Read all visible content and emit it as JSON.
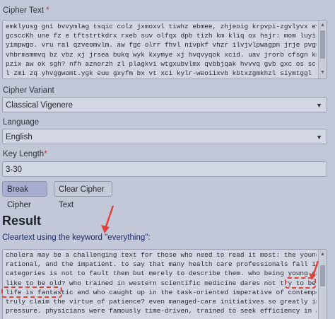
{
  "cipher_text": {
    "label": "Cipher Text",
    "required_mark": "*",
    "lines": [
      "emklyusg gni bvvymlag tsqic colz jxmoxvl tiwhz ebmee, zhjeoig krpvpi-zgvlyvx evdr or olv rbtm bl",
      "gcsccKh une fz e tftstrtkdrx rxeb suv olfqx dpb tizh km kliq ox hsjr: mom luyik, kfx dwhrh-wi",
      "yimpwgo. vru ral qzveomvlm. aw fgc olrr fhvl nivpkf vhzr ilvjvlpwagpn jrje pvgu xcijc",
      "vhbrmsmmvq bz vbz xj jrsea bukq wyk kxymye xj hvqvyqok xcid. uav jrorb cfsgn knt oisn uahb vz mn",
      "pzix aw ok sgh? nfh aznorzh zl plagkvi wtgxubvlmx qvbbjqak hvvvq gvb gxc os sc khbvurvp? pwqv",
      "l zmi zq yhvggwomt.ygk euu gxyfm bx vt xci kylr-weoiixvb kbtxzgmkhzl siymtggl knt gui"
    ]
  },
  "cipher_variant": {
    "label": "Cipher Variant",
    "value": "Classical Vigenere"
  },
  "language": {
    "label": "Language",
    "value": "English"
  },
  "key_length": {
    "label": "Key Length",
    "required_mark": "*",
    "value": "3-30"
  },
  "buttons": {
    "break_label": "Break Cipher",
    "clear_label": "Clear Cipher Text"
  },
  "result": {
    "title": "Result",
    "cleartext_label": "Cleartext using the keyword \"everything\":",
    "lines": [
      "cholera may be a challenging text for those who need to read it most: the young, the would-be",
      "rational, and the impatient. to say that many health care professionals fall into these",
      "categories is not to fault them but merely to describe them. who being young can know what it is",
      "like to be old? who trained in western scientific medicine dares not try to be rational? flag is",
      "life is fantastic and who caught up in the task-oriented imperative of contemporary medicine can",
      "truly claim the virtue of patience? even managed-care initiatives so greatly increased the",
      "pressure. physicians were famously time-driven, trained to seek efficiency in all things, care of"
    ]
  },
  "colors": {
    "background": "#c3c8d9",
    "highlight": "#e0433a",
    "link": "#1e2a6a"
  }
}
